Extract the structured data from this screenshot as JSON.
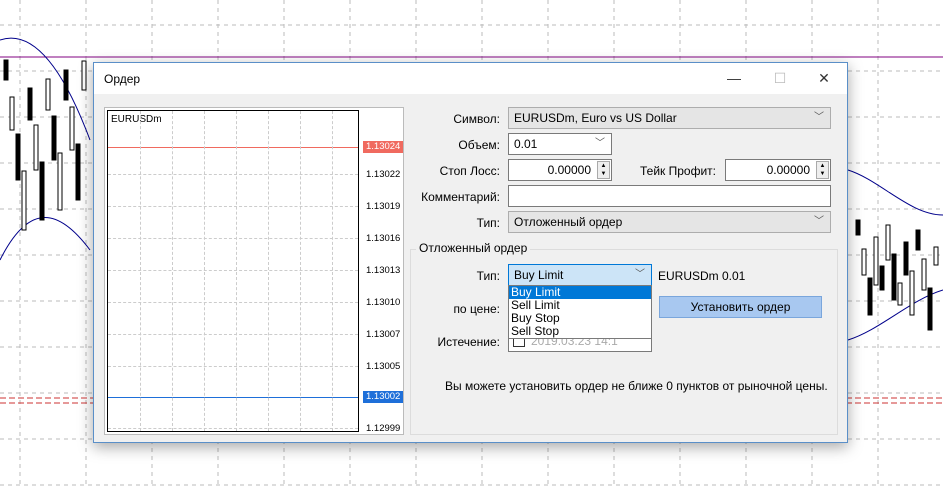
{
  "dialog": {
    "title": "Ордер",
    "minimize": "—",
    "maximize": "☐",
    "close": "✕"
  },
  "mini_chart": {
    "symbol": "EURUSDm",
    "price_labels": [
      "1.13024",
      "1.13022",
      "1.13019",
      "1.13016",
      "1.13013",
      "1.13010",
      "1.13007",
      "1.13005",
      "1.13002",
      "1.12999"
    ],
    "ask": "1.13024",
    "bid": "1.13002",
    "ask_color": "#f06a5f",
    "bid_color": "#1e6fd9"
  },
  "form": {
    "symbol_label": "Символ:",
    "symbol_value": "EURUSDm, Euro vs US Dollar",
    "volume_label": "Объем:",
    "volume_value": "0.01",
    "sl_label": "Стоп Лосс:",
    "sl_value": "0.00000",
    "tp_label": "Тейк Профит:",
    "tp_value": "0.00000",
    "comment_label": "Комментарий:",
    "comment_value": "",
    "type_label": "Тип:",
    "type_value": "Отложенный ордер"
  },
  "pending": {
    "group_title": "Отложенный ордер",
    "type_label": "Тип:",
    "type_value": "Buy Limit",
    "info": "EURUSDm 0.01",
    "price_label": "по цене:",
    "expiry_label": "Истечение:",
    "expiry_value": "2019.03.23 14:1",
    "options": [
      "Buy Limit",
      "Sell Limit",
      "Buy Stop",
      "Sell Stop"
    ],
    "submit": "Установить ордер",
    "note": "Вы можете установить ордер не ближе 0 пунктов от рыночной цены."
  }
}
